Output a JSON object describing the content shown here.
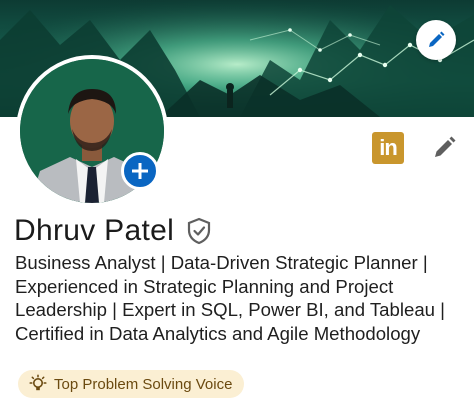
{
  "profile": {
    "name": "Dhruv Patel",
    "headline": "Business Analyst | Data-Driven Strategic Planner | Experienced in Strategic Planning and Project Leadership | Expert in SQL, Power BI, and Tableau | Certified in Data Analytics and Agile Methodology",
    "badge_label": "Top Problem Solving Voice",
    "linkedin_logo_text": "in"
  },
  "icons": {
    "edit_banner": "pencil-icon",
    "add_photo": "plus-icon",
    "linkedin": "linkedin-icon",
    "edit_profile": "pencil-icon",
    "verified": "shield-check-icon",
    "badge": "lightbulb-icon"
  },
  "colors": {
    "primary_blue": "#0a66c2",
    "linkedin_badge": "#c9962d",
    "voice_badge_bg": "#fbefd3",
    "voice_badge_text": "#6b4a10"
  }
}
